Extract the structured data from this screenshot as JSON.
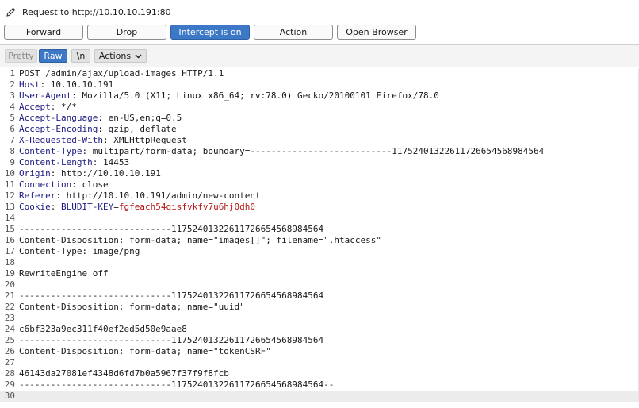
{
  "window": {
    "title": "Request to http://10.10.10.191:80"
  },
  "buttons": {
    "forward": "Forward",
    "drop": "Drop",
    "intercept": "Intercept is on",
    "action": "Action",
    "open_browser": "Open Browser"
  },
  "view": {
    "pretty": "Pretty",
    "raw": "Raw",
    "newline": "\\n",
    "actions": "Actions"
  },
  "colors": {
    "accent": "#3d78c7",
    "header_key": "#1c1a80",
    "cookie_value": "#b51616"
  },
  "icons": {
    "edit": "pencil-icon",
    "actions_menu": "chevron-down-icon"
  },
  "request": {
    "lines": [
      {
        "n": "1",
        "text": "POST /admin/ajax/upload-images HTTP/1.1"
      },
      {
        "n": "2",
        "key": "Host",
        "value": ": 10.10.10.191"
      },
      {
        "n": "3",
        "key": "User-Agent",
        "value": ": Mozilla/5.0 (X11; Linux x86_64; rv:78.0) Gecko/20100101 Firefox/78.0"
      },
      {
        "n": "4",
        "key": "Accept",
        "value": ": */*"
      },
      {
        "n": "5",
        "key": "Accept-Language",
        "value": ": en-US,en;q=0.5"
      },
      {
        "n": "6",
        "key": "Accept-Encoding",
        "value": ": gzip, deflate"
      },
      {
        "n": "7",
        "key": "X-Requested-With",
        "value": ": XMLHttpRequest"
      },
      {
        "n": "8",
        "key": "Content-Type",
        "value": ": multipart/form-data; boundary=---------------------------117524013226117266545689845​64"
      },
      {
        "n": "9",
        "key": "Content-Length",
        "value": ": 14453"
      },
      {
        "n": "10",
        "key": "Origin",
        "value": ": http://10.10.10.191"
      },
      {
        "n": "11",
        "key": "Connection",
        "value": ": close"
      },
      {
        "n": "12",
        "key": "Referer",
        "value": ": http://10.10.10.191/admin/new-content"
      },
      {
        "n": "13",
        "key": "Cookie",
        "value": ": ",
        "cookie_key": "BLUDIT-KEY",
        "cookie_eq": "=",
        "cookie_value": "fgfeach54qisfvkfv7u6hj0dh0"
      },
      {
        "n": "14",
        "text": ""
      },
      {
        "n": "15",
        "text": "-----------------------------11752401322611726654568984564"
      },
      {
        "n": "16",
        "text": "Content-Disposition: form-data; name=\"images[]\"; filename=\".htaccess\""
      },
      {
        "n": "17",
        "text": "Content-Type: image/png"
      },
      {
        "n": "18",
        "text": ""
      },
      {
        "n": "19",
        "text": "RewriteEngine off"
      },
      {
        "n": "20",
        "text": ""
      },
      {
        "n": "21",
        "text": "-----------------------------11752401322611726654568984564"
      },
      {
        "n": "22",
        "text": "Content-Disposition: form-data; name=\"uuid\""
      },
      {
        "n": "23",
        "text": ""
      },
      {
        "n": "24",
        "text": "c6bf323a9ec311f40ef2ed5d50e9aae8"
      },
      {
        "n": "25",
        "text": "-----------------------------11752401322611726654568984564"
      },
      {
        "n": "26",
        "text": "Content-Disposition: form-data; name=\"tokenCSRF\""
      },
      {
        "n": "27",
        "text": ""
      },
      {
        "n": "28",
        "text": "46143da27081ef4348d6fd7b0a5967f37f9f8fcb"
      },
      {
        "n": "29",
        "text": "-----------------------------11752401322611726654568984564--"
      },
      {
        "n": "30",
        "text": ""
      }
    ]
  }
}
